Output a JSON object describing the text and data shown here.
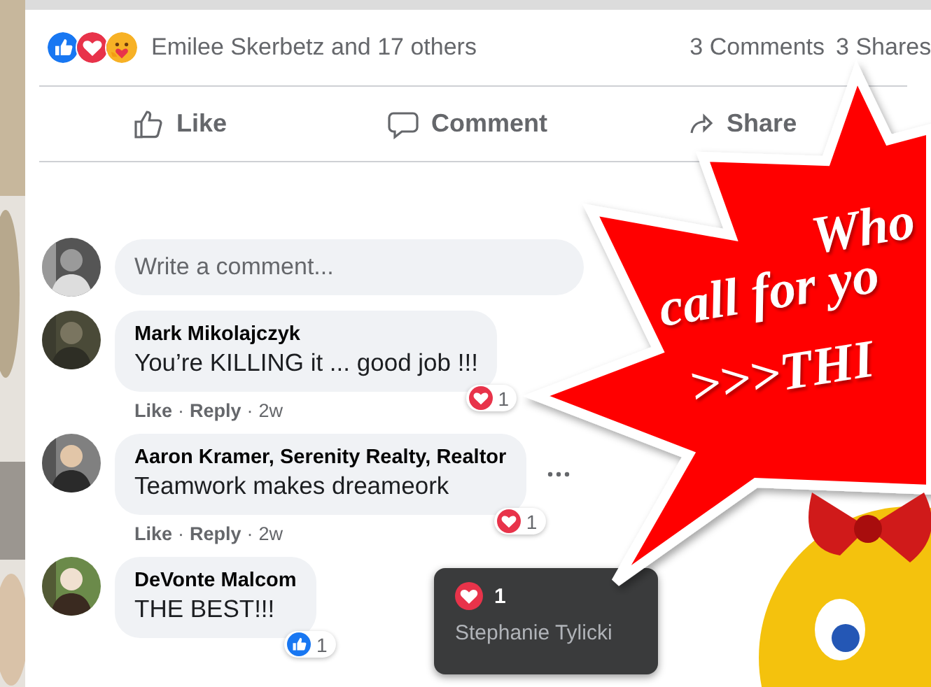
{
  "reactions": {
    "icons": [
      {
        "kind": "like"
      },
      {
        "kind": "love"
      },
      {
        "kind": "care"
      }
    ],
    "summary": "Emilee Skerbetz and 17 others",
    "comments_count": "3 Comments",
    "shares_count": "3 Shares"
  },
  "actions": [
    {
      "kind": "like",
      "label": "Like"
    },
    {
      "kind": "comment",
      "label": "Comment"
    },
    {
      "kind": "share",
      "label": "Share"
    }
  ],
  "composer": {
    "placeholder": "Write a comment..."
  },
  "comments": [
    {
      "author": "Mark Mikolajczyk",
      "text": "You’re KILLING it ... good job !!!",
      "menu": false,
      "reaction": {
        "kind": "love",
        "count": "1"
      },
      "meta": [
        {
          "kind": "link",
          "text": "Like"
        },
        {
          "kind": "dot",
          "text": "·"
        },
        {
          "kind": "link",
          "text": "Reply"
        },
        {
          "kind": "dot",
          "text": "·"
        },
        {
          "kind": "time",
          "text": "2w"
        }
      ]
    },
    {
      "author": "Aaron Kramer, Serenity Realty, Realtor",
      "text": "Teamwork makes dreameork",
      "menu": true,
      "reaction": {
        "kind": "love",
        "count": "1"
      },
      "meta": [
        {
          "kind": "link",
          "text": "Like"
        },
        {
          "kind": "dot",
          "text": "·"
        },
        {
          "kind": "link",
          "text": "Reply"
        },
        {
          "kind": "dot",
          "text": "·"
        },
        {
          "kind": "time",
          "text": "2w"
        }
      ]
    },
    {
      "author": "DeVonte Malcom",
      "text": "THE BEST!!!",
      "menu": false,
      "reaction": {
        "kind": "like",
        "count": "1"
      }
    }
  ],
  "tooltip": {
    "kind": "love",
    "count": "1",
    "name": "Stephanie Tylicki"
  },
  "banner": {
    "lines": [
      "Who",
      "call for yo",
      ">>>THI"
    ]
  }
}
